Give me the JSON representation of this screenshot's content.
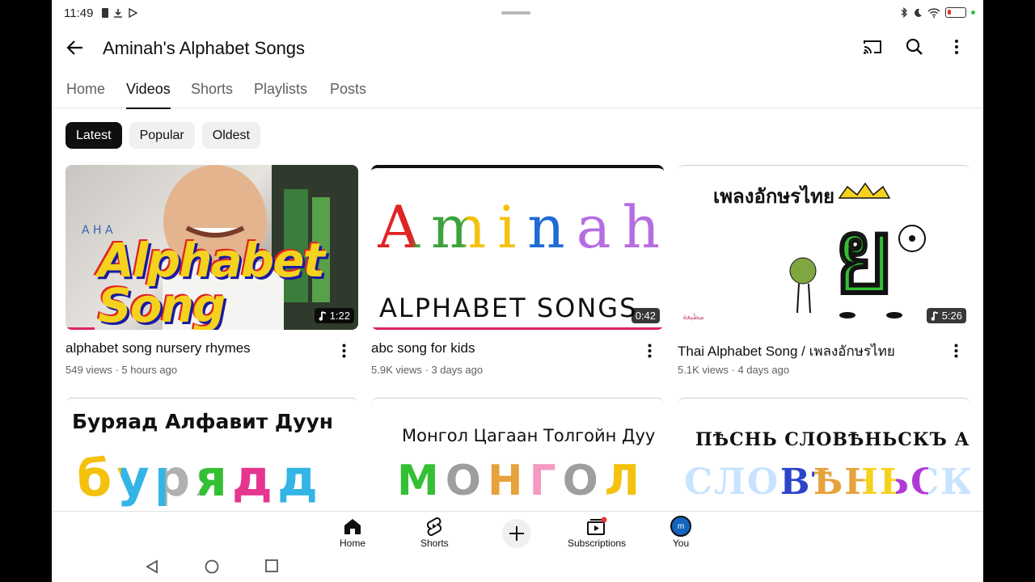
{
  "status": {
    "time": "11:49"
  },
  "header": {
    "title": "Aminah's Alphabet Songs"
  },
  "tabs": [
    {
      "label": "Home"
    },
    {
      "label": "Videos"
    },
    {
      "label": "Shorts"
    },
    {
      "label": "Playlists"
    },
    {
      "label": "Posts"
    }
  ],
  "chips": [
    {
      "label": "Latest"
    },
    {
      "label": "Popular"
    },
    {
      "label": "Oldest"
    }
  ],
  "videos": [
    {
      "title": "alphabet song nursery rhymes",
      "views": "549 views",
      "age": "5 hours ago",
      "duration": "1:22",
      "thumb_text": "Alphabet Song"
    },
    {
      "title": "abc song for kids",
      "views": "5.9K views",
      "age": "3 days ago",
      "duration": "0:42",
      "thumb_logo": "Aminah's",
      "thumb_text": "ALPHABET SONGS"
    },
    {
      "title": "Thai Alphabet Song / เพลงอักษรไทย",
      "views": "5.1K views",
      "age": "4 days ago",
      "duration": "5:26",
      "thumb_text": "เพลงอักษรไทย",
      "thumb_letter": "ย"
    },
    {
      "thumb_text": "Буряад Алфавит Дуун",
      "thumb_letters": "бурядд"
    },
    {
      "thumb_text": "Монгол Цагаан Толгойн Дуу",
      "thumb_letters": "МОНГОЛ"
    },
    {
      "thumb_text": "ПѢСНЬ СЛОВѢНЬСКЪ АЗЪБУКЫ",
      "thumb_letters": "СЛОВѢНЬСКЪ"
    }
  ],
  "meta_separator": "·",
  "bottom_nav": [
    {
      "label": "Home"
    },
    {
      "label": "Shorts"
    },
    {
      "label": "Subscriptions"
    },
    {
      "label": "You",
      "avatar": "m"
    }
  ],
  "colors": {
    "accent": "#e0245e",
    "chip_active": "#0f0f0f",
    "avatar": "#1565c0"
  }
}
